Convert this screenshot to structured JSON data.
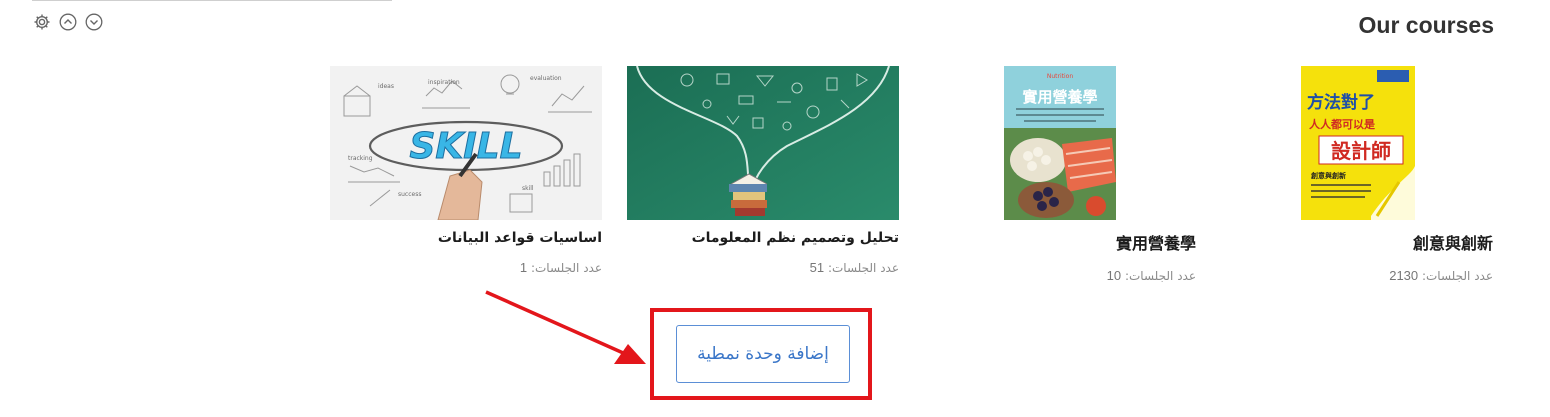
{
  "section": {
    "title": "Our courses"
  },
  "controls": {
    "settings_icon": "gear-icon",
    "move_up_icon": "chevron-up-circle-icon",
    "move_down_icon": "chevron-down-circle-icon"
  },
  "courses": [
    {
      "name": "اساسيات قواعد البيانات",
      "sessions_label": "عدد الجلسات:",
      "sessions": "1",
      "image_text": "SKILL",
      "sketch_words": [
        "ideas",
        "inspiration",
        "evaluation",
        "tracking",
        "success",
        "skill"
      ]
    },
    {
      "name": "تحليل وتصميم نظم المعلومات",
      "sessions_label": "عدد الجلسات:",
      "sessions": "51"
    },
    {
      "name": "實用營養學",
      "sessions_label": "عدد الجلسات:",
      "sessions": "10",
      "cover_title": "實用營養學",
      "cover_subtitle": "Nutrition"
    },
    {
      "name": "創意與創新",
      "sessions_label": "عدد الجلسات:",
      "sessions": "2130",
      "cover_title_1": "方法對了",
      "cover_title_2": "人人都可以是",
      "cover_title_3": "設計師",
      "cover_badge": "創意與創新"
    }
  ],
  "add_module_button": {
    "label": "إضافة وحدة نمطية"
  },
  "colors": {
    "highlight": "#e3161b",
    "button_border": "#5b8fd6",
    "button_text": "#3a76c8",
    "chalkboard": "#1f7a5e",
    "cover_yellow": "#f5e10c"
  }
}
